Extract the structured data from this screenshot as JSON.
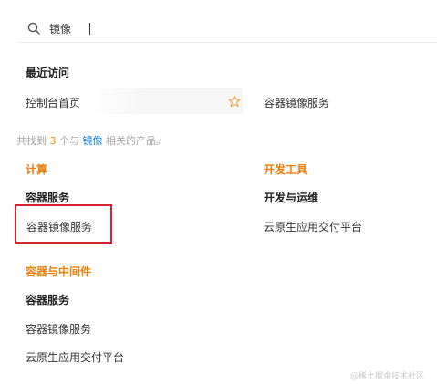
{
  "search": {
    "value": "镜像",
    "icon": "search-icon"
  },
  "recent": {
    "title": "最近访问",
    "items": [
      {
        "label": "控制台首页",
        "icon": "star-icon"
      },
      {
        "label": "容器镜像服务"
      }
    ]
  },
  "results_summary": {
    "prefix": "共找到",
    "count": "3",
    "middle": "个与",
    "keyword": "镜像",
    "suffix": "相关的产品。"
  },
  "categories": [
    {
      "title": "计算",
      "groups": [
        {
          "title": "容器服务",
          "items": [
            "容器镜像服务"
          ]
        }
      ]
    },
    {
      "title": "开发工具",
      "groups": [
        {
          "title": "开发与运维",
          "items": [
            "云原生应用交付平台"
          ]
        }
      ]
    },
    {
      "title": "容器与中间件",
      "groups": [
        {
          "title": "容器服务",
          "items": [
            "容器镜像服务",
            "云原生应用交付平台"
          ]
        }
      ]
    }
  ],
  "watermark": "@稀土掘金技术社区",
  "colors": {
    "category": "#ee7f0a",
    "keyword": "#0d7fd4",
    "count": "#ff8a00",
    "highlight_box": "#d7212d",
    "star": "#f0a04b"
  }
}
